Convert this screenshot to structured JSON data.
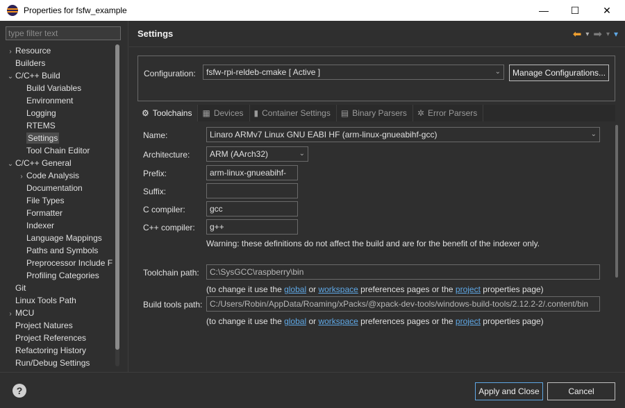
{
  "window": {
    "title": "Properties for fsfw_example",
    "controls": [
      "—",
      "☐",
      "✕"
    ]
  },
  "filter": {
    "placeholder": "type filter text"
  },
  "tree": [
    {
      "label": "Resource",
      "indent": 0,
      "arrow": "›",
      "selected": false
    },
    {
      "label": "Builders",
      "indent": 0,
      "arrow": "",
      "selected": false
    },
    {
      "label": "C/C++ Build",
      "indent": 0,
      "arrow": "⌄",
      "selected": false
    },
    {
      "label": "Build Variables",
      "indent": 1,
      "arrow": "",
      "selected": false
    },
    {
      "label": "Environment",
      "indent": 1,
      "arrow": "",
      "selected": false
    },
    {
      "label": "Logging",
      "indent": 1,
      "arrow": "",
      "selected": false
    },
    {
      "label": "RTEMS",
      "indent": 1,
      "arrow": "",
      "selected": false
    },
    {
      "label": "Settings",
      "indent": 1,
      "arrow": "",
      "selected": true
    },
    {
      "label": "Tool Chain Editor",
      "indent": 1,
      "arrow": "",
      "selected": false
    },
    {
      "label": "C/C++ General",
      "indent": 0,
      "arrow": "⌄",
      "selected": false
    },
    {
      "label": "Code Analysis",
      "indent": 1,
      "arrow": "›",
      "selected": false
    },
    {
      "label": "Documentation",
      "indent": 1,
      "arrow": "",
      "selected": false
    },
    {
      "label": "File Types",
      "indent": 1,
      "arrow": "",
      "selected": false
    },
    {
      "label": "Formatter",
      "indent": 1,
      "arrow": "",
      "selected": false
    },
    {
      "label": "Indexer",
      "indent": 1,
      "arrow": "",
      "selected": false
    },
    {
      "label": "Language Mappings",
      "indent": 1,
      "arrow": "",
      "selected": false
    },
    {
      "label": "Paths and Symbols",
      "indent": 1,
      "arrow": "",
      "selected": false
    },
    {
      "label": "Preprocessor Include F",
      "indent": 1,
      "arrow": "",
      "selected": false
    },
    {
      "label": "Profiling Categories",
      "indent": 1,
      "arrow": "",
      "selected": false
    },
    {
      "label": "Git",
      "indent": 0,
      "arrow": "",
      "selected": false
    },
    {
      "label": "Linux Tools Path",
      "indent": 0,
      "arrow": "",
      "selected": false
    },
    {
      "label": "MCU",
      "indent": 0,
      "arrow": "›",
      "selected": false
    },
    {
      "label": "Project Natures",
      "indent": 0,
      "arrow": "",
      "selected": false
    },
    {
      "label": "Project References",
      "indent": 0,
      "arrow": "",
      "selected": false
    },
    {
      "label": "Refactoring History",
      "indent": 0,
      "arrow": "",
      "selected": false
    },
    {
      "label": "Run/Debug Settings",
      "indent": 0,
      "arrow": "",
      "selected": false
    }
  ],
  "header": {
    "title": "Settings"
  },
  "nav": {
    "back": "⬅",
    "forward": "➡",
    "menu": "▾"
  },
  "configuration": {
    "label": "Configuration:",
    "value": "fsfw-rpi-reldeb-cmake  [ Active ]",
    "manage_label": "Manage Configurations..."
  },
  "tabs": [
    {
      "label": "Toolchains",
      "icon": "⚙",
      "icon_name": "gear-icon",
      "active": true
    },
    {
      "label": "Devices",
      "icon": "▦",
      "icon_name": "chip-icon",
      "active": false
    },
    {
      "label": "Container Settings",
      "icon": "▮",
      "icon_name": "container-icon",
      "active": false
    },
    {
      "label": "Binary Parsers",
      "icon": "▤",
      "icon_name": "binary-icon",
      "active": false
    },
    {
      "label": "Error Parsers",
      "icon": "✲",
      "icon_name": "error-icon",
      "active": false
    }
  ],
  "form": {
    "name_label": "Name:",
    "name_value": "Linaro ARMv7 Linux GNU EABI HF (arm-linux-gnueabihf-gcc)",
    "arch_label": "Architecture:",
    "arch_value": "ARM (AArch32)",
    "prefix_label": "Prefix:",
    "prefix_value": "arm-linux-gnueabihf-",
    "suffix_label": "Suffix:",
    "suffix_value": "",
    "c_label": "C compiler:",
    "c_value": "gcc",
    "cpp_label": "C++ compiler:",
    "cpp_value": "g++",
    "warning": "Warning: these definitions do not affect the build and are for the benefit of the indexer only.",
    "toolchain_path_label": "Toolchain path:",
    "toolchain_path_value": "C:\\SysGCC\\raspberry\\bin",
    "build_tools_path_label": "Build tools path:",
    "build_tools_path_value": "C:/Users/Robin/AppData/Roaming/xPacks/@xpack-dev-tools/windows-build-tools/2.12.2-2/.content/bin",
    "note_prefix": "(to change it use the ",
    "note_global": "global",
    "note_or": " or ",
    "note_workspace": "workspace",
    "note_middle": " preferences pages or the ",
    "note_project": "project",
    "note_suffix": " properties page)"
  },
  "footer": {
    "help": "?",
    "apply_close": "Apply and Close",
    "cancel": "Cancel"
  }
}
